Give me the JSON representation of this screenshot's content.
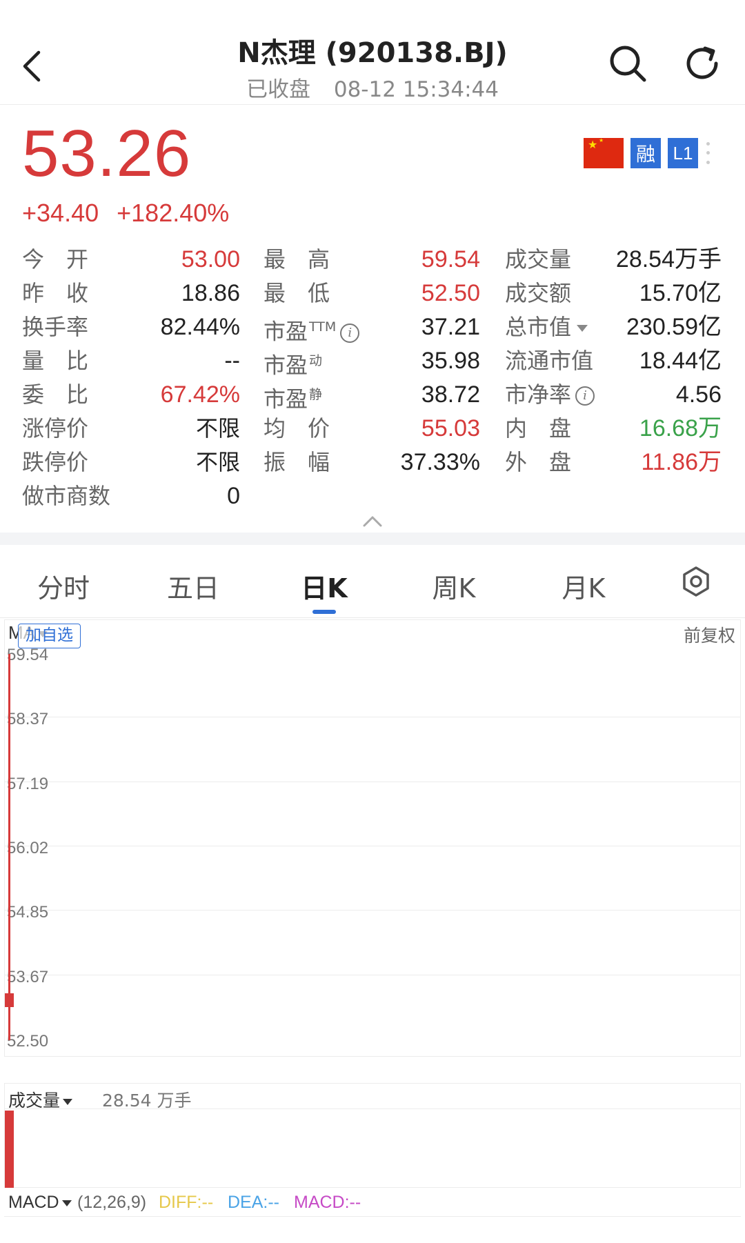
{
  "header": {
    "title": "N杰理 (920138.BJ)",
    "status": "已收盘",
    "timestamp": "08-12 15:34:44"
  },
  "quote": {
    "price": "53.26",
    "change": "+34.40",
    "change_pct": "+182.40%",
    "badges": {
      "rong": "融",
      "level": "L1"
    }
  },
  "stats": {
    "col1": [
      {
        "label": "今　开",
        "value": "53.00",
        "color": "red"
      },
      {
        "label": "昨　收",
        "value": "18.86",
        "color": "normal"
      },
      {
        "label": "换手率",
        "value": "82.44%",
        "color": "normal"
      },
      {
        "label": "量　比",
        "value": "--",
        "color": "normal"
      },
      {
        "label": "委　比",
        "value": "67.42%",
        "color": "red"
      },
      {
        "label": "涨停价",
        "value": "不限",
        "color": "normal"
      },
      {
        "label": "跌停价",
        "value": "不限",
        "color": "normal"
      },
      {
        "label": "做市商数",
        "value": "0",
        "color": "normal"
      }
    ],
    "col2": [
      {
        "label": "最　高",
        "sup": "",
        "value": "59.54",
        "color": "red"
      },
      {
        "label": "最　低",
        "sup": "",
        "value": "52.50",
        "color": "red"
      },
      {
        "label": "市盈",
        "sup": "TTM",
        "value": "37.21",
        "color": "normal"
      },
      {
        "label": "市盈",
        "sup": "动",
        "value": "35.98",
        "color": "normal"
      },
      {
        "label": "市盈",
        "sup": "静",
        "value": "38.72",
        "color": "normal"
      },
      {
        "label": "均　价",
        "sup": "",
        "value": "55.03",
        "color": "red"
      },
      {
        "label": "振　幅",
        "sup": "",
        "value": "37.33%",
        "color": "normal"
      }
    ],
    "col3": [
      {
        "label": "成交量",
        "value": "28.54万手",
        "color": "normal"
      },
      {
        "label": "成交额",
        "value": "15.70亿",
        "color": "normal"
      },
      {
        "label": "总市值",
        "value": "230.59亿",
        "color": "normal"
      },
      {
        "label": "流通市值",
        "value": "18.44亿",
        "color": "normal"
      },
      {
        "label": "市净率",
        "value": "4.56",
        "color": "normal"
      },
      {
        "label": "内　盘",
        "value": "16.68万",
        "color": "green"
      },
      {
        "label": "外　盘",
        "value": "11.86万",
        "color": "red"
      }
    ]
  },
  "tabs": [
    "分时",
    "五日",
    "日K",
    "周K",
    "月K"
  ],
  "active_tab": "日K",
  "chart": {
    "ma_label": "MA",
    "add_watch": "加自选",
    "adjust": "前复权",
    "y_ticks": [
      "59.54",
      "58.37",
      "57.19",
      "56.02",
      "54.85",
      "53.67",
      "52.50"
    ],
    "candle": {
      "open": 53.0,
      "close": 53.26,
      "high": 59.54,
      "low": 52.5
    }
  },
  "volume": {
    "label": "成交量",
    "value": "28.54 万手"
  },
  "macd": {
    "label": "MACD",
    "params": "(12,26,9)",
    "diff": "DIFF:--",
    "dea": "DEA:--",
    "macd": "MACD:--",
    "colors": {
      "diff": "#e6c84a",
      "dea": "#4aa3e6",
      "macd": "#c64ac6"
    }
  },
  "colors": {
    "up": "#d63a3a",
    "down": "#3aa24a",
    "accent": "#2f6fd6"
  }
}
